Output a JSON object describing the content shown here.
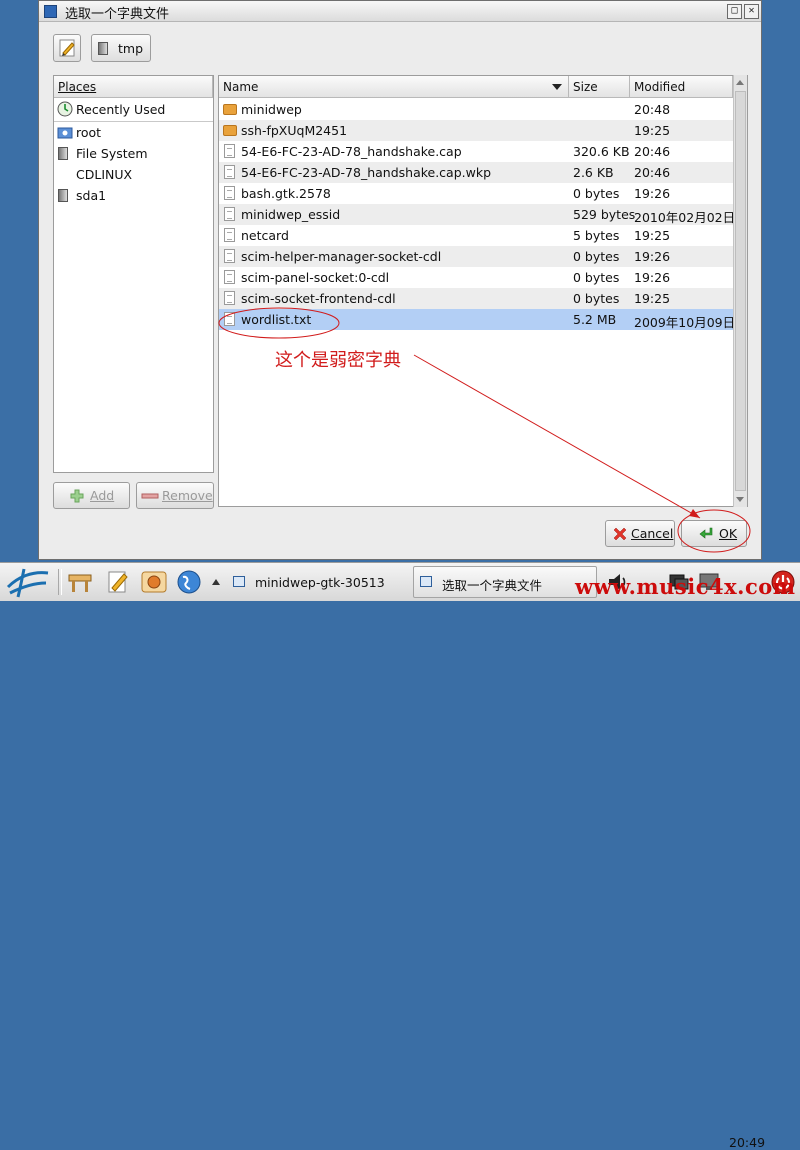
{
  "dialog": {
    "title": "选取一个字典文件",
    "close_glyph": "✕",
    "maximize_glyph": "□"
  },
  "path_bar": {
    "current_folder": "tmp"
  },
  "places": {
    "header": "Places",
    "items": [
      {
        "label": "Recently Used",
        "icon": "recently-used-icon"
      },
      {
        "label": "root",
        "icon": "home-folder-icon"
      },
      {
        "label": "File System",
        "icon": "drive-icon"
      },
      {
        "label": "CDLINUX",
        "icon": ""
      },
      {
        "label": "sda1",
        "icon": "drive-icon"
      }
    ],
    "add_label": "Add",
    "remove_label": "Remove"
  },
  "files": {
    "columns": {
      "name": "Name",
      "size": "Size",
      "modified": "Modified"
    },
    "rows": [
      {
        "name": "minidwep",
        "size": "",
        "modified": "20:48",
        "type": "folder"
      },
      {
        "name": "ssh-fpXUqM2451",
        "size": "",
        "modified": "19:25",
        "type": "folder"
      },
      {
        "name": "54-E6-FC-23-AD-78_handshake.cap",
        "size": "320.6 KB",
        "modified": "20:46",
        "type": "file"
      },
      {
        "name": "54-E6-FC-23-AD-78_handshake.cap.wkp",
        "size": "2.6 KB",
        "modified": "20:46",
        "type": "file"
      },
      {
        "name": "bash.gtk.2578",
        "size": "0 bytes",
        "modified": "19:26",
        "type": "file"
      },
      {
        "name": "minidwep_essid",
        "size": "529 bytes",
        "modified": "2010年02月02日",
        "type": "file"
      },
      {
        "name": "netcard",
        "size": "5 bytes",
        "modified": "19:25",
        "type": "file"
      },
      {
        "name": "scim-helper-manager-socket-cdl",
        "size": "0 bytes",
        "modified": "19:26",
        "type": "file"
      },
      {
        "name": "scim-panel-socket:0-cdl",
        "size": "0 bytes",
        "modified": "19:26",
        "type": "file"
      },
      {
        "name": "scim-socket-frontend-cdl",
        "size": "0 bytes",
        "modified": "19:25",
        "type": "file"
      },
      {
        "name": "wordlist.txt",
        "size": "5.2 MB",
        "modified": "2009年10月09日",
        "type": "file",
        "selected": true
      }
    ]
  },
  "buttons": {
    "cancel_label": "Cancel",
    "ok_label": "OK"
  },
  "annotation": {
    "text": "这个是弱密字典",
    "color": "#d11b1b"
  },
  "taskbar": {
    "tasks": [
      {
        "label": "minidwep-gtk-30513"
      },
      {
        "label": "选取一个字典文件",
        "active": true
      }
    ],
    "clock": "20:49"
  },
  "watermark": "www.music4x.com"
}
